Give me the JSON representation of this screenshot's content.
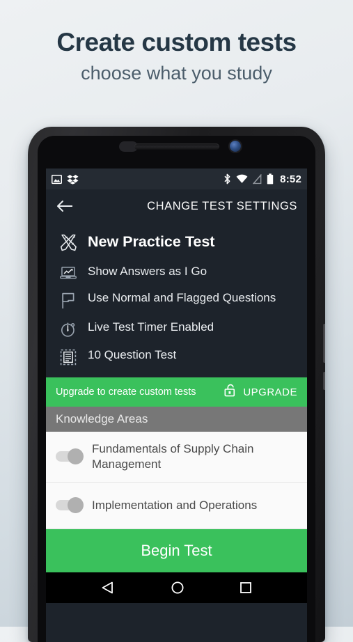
{
  "promo": {
    "title": "Create custom tests",
    "subtitle": "choose what you study"
  },
  "statusbar": {
    "icons_left": [
      "image-icon",
      "dropbox-icon"
    ],
    "icons_right": [
      "bluetooth-icon",
      "wifi-icon",
      "signal-off-icon",
      "battery-icon"
    ],
    "time": "8:52"
  },
  "appbar": {
    "back_icon": "back-arrow-icon",
    "title": "CHANGE TEST SETTINGS"
  },
  "settings": [
    {
      "icon": "pencil-ruler-icon",
      "label": "New Practice Test",
      "primary": true
    },
    {
      "icon": "laptop-chart-icon",
      "label": "Show Answers as I Go",
      "primary": false
    },
    {
      "icon": "flag-icon",
      "label": "Use Normal and Flagged Questions",
      "primary": false
    },
    {
      "icon": "stopwatch-icon",
      "label": "Live Test Timer Enabled",
      "primary": false
    },
    {
      "icon": "document-list-icon",
      "label": "10 Question Test",
      "primary": false
    }
  ],
  "upgrade_banner": {
    "text": "Upgrade to create custom tests",
    "action_label": "UPGRADE",
    "action_icon": "unlock-icon",
    "color": "#3ac15c"
  },
  "section": {
    "title": "Knowledge Areas",
    "color": "#777777"
  },
  "knowledge_areas": [
    {
      "label": "Fundamentals of Supply Chain Management",
      "toggle_state": "on-disabled"
    },
    {
      "label": "Implementation and Operations",
      "toggle_state": "on-disabled"
    }
  ],
  "begin_button": {
    "label": "Begin Test",
    "color": "#3ac15c"
  },
  "navbar": {
    "buttons": [
      "nav-back-icon",
      "nav-home-icon",
      "nav-recents-icon"
    ]
  },
  "theme": {
    "screen_bg": "#1d232b",
    "statusbar_bg": "#252b33",
    "accent_green": "#3ac15c",
    "promo_title_color": "#253745"
  }
}
